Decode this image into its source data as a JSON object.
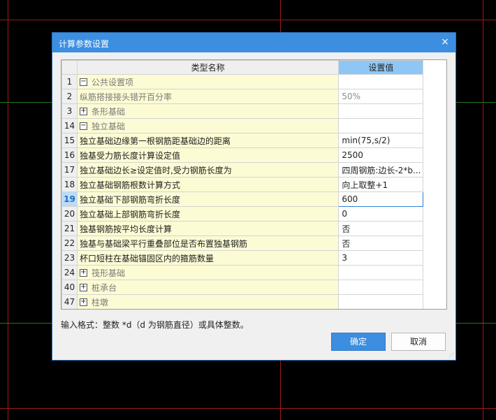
{
  "dialog": {
    "title": "计算参数设置",
    "close_glyph": "×",
    "column_name": "类型名称",
    "column_value": "设置值",
    "hint": "输入格式：整数 *d（d 为钢筋直径）或具体整数。",
    "ok_label": "确定",
    "cancel_label": "取消"
  },
  "rows": [
    {
      "num": "1",
      "expander": "−",
      "name": "公共设置项",
      "value": ""
    },
    {
      "num": "2",
      "expander": "",
      "name": "纵筋搭接接头错开百分率",
      "value": "50%"
    },
    {
      "num": "3",
      "expander": "+",
      "name": "条形基础",
      "value": ""
    },
    {
      "num": "14",
      "expander": "−",
      "name": "独立基础",
      "value": ""
    },
    {
      "num": "15",
      "expander": "",
      "name": "独立基础边缘第一根钢筋距基础边的距离",
      "value": "min(75,s/2)"
    },
    {
      "num": "16",
      "expander": "",
      "name": "独基受力筋长度计算设定值",
      "value": "2500"
    },
    {
      "num": "17",
      "expander": "",
      "name": "独立基础边长≥设定值时,受力钢筋长度为",
      "value": "四周钢筋:边长-2*b..."
    },
    {
      "num": "18",
      "expander": "",
      "name": "独立基础钢筋根数计算方式",
      "value": "向上取整+1"
    },
    {
      "num": "19",
      "expander": "",
      "name": "独立基础下部钢筋弯折长度",
      "value": "600"
    },
    {
      "num": "20",
      "expander": "",
      "name": "独立基础上部钢筋弯折长度",
      "value": "0"
    },
    {
      "num": "21",
      "expander": "",
      "name": "独基钢筋按平均长度计算",
      "value": "否"
    },
    {
      "num": "22",
      "expander": "",
      "name": "独基与基础梁平行重叠部位是否布置独基钢筋",
      "value": "否"
    },
    {
      "num": "23",
      "expander": "",
      "name": "杯口短柱在基础锚固区内的箍筋数量",
      "value": "3"
    },
    {
      "num": "24",
      "expander": "+",
      "name": "筏形基础",
      "value": ""
    },
    {
      "num": "40",
      "expander": "+",
      "name": "桩承台",
      "value": ""
    },
    {
      "num": "47",
      "expander": "+",
      "name": "柱墩",
      "value": ""
    }
  ]
}
